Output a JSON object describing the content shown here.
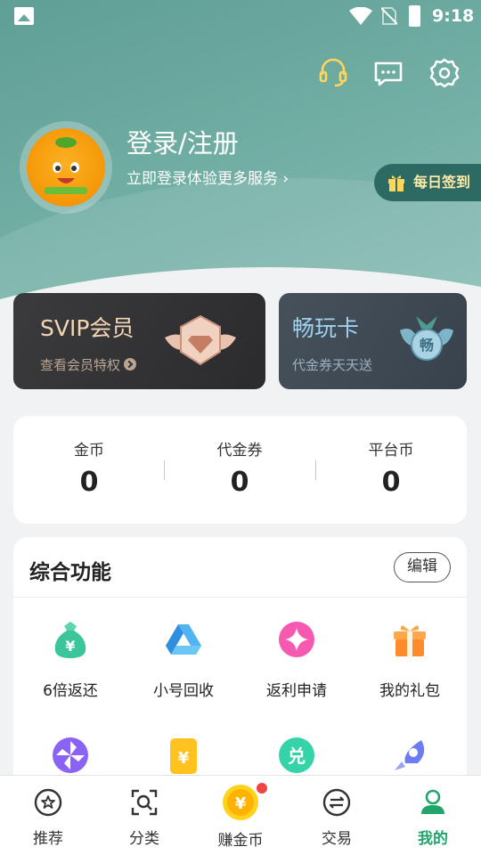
{
  "status_bar": {
    "time": "9:18"
  },
  "profile": {
    "login_title": "登录/注册",
    "login_subtitle": "立即登录体验更多服务",
    "checkin_label": "每日签到"
  },
  "cards": {
    "svip": {
      "title": "SVIP会员",
      "subtitle": "查看会员特权"
    },
    "play": {
      "title": "畅玩卡",
      "subtitle": "代金券天天送",
      "badge_text": "畅"
    }
  },
  "currency": [
    {
      "label": "金币",
      "value": "0"
    },
    {
      "label": "代金券",
      "value": "0"
    },
    {
      "label": "平台币",
      "value": "0"
    }
  ],
  "functions": {
    "title": "综合功能",
    "edit_label": "编辑",
    "items": [
      {
        "label": "6倍返还",
        "icon": "money-bag-icon"
      },
      {
        "label": "小号回收",
        "icon": "recycle-triangle-icon"
      },
      {
        "label": "返利申请",
        "icon": "sparkle-icon"
      },
      {
        "label": "我的礼包",
        "icon": "gift-box-icon"
      }
    ],
    "row2_icons": [
      "pinwheel-icon",
      "yen-card-icon",
      "exchange-icon",
      "rocket-icon"
    ],
    "row2_glyphs": {
      "yen": "¥",
      "exchange": "兑"
    }
  },
  "bottom_nav": [
    {
      "label": "推荐"
    },
    {
      "label": "分类"
    },
    {
      "label": "赚金币"
    },
    {
      "label": "交易"
    },
    {
      "label": "我的"
    }
  ],
  "colors": {
    "header": "#6aa79e",
    "active_nav": "#21a56d",
    "svip_text": "#f4d6b5",
    "play_text": "#9ed2ee",
    "notify_dot": "#f04545"
  }
}
